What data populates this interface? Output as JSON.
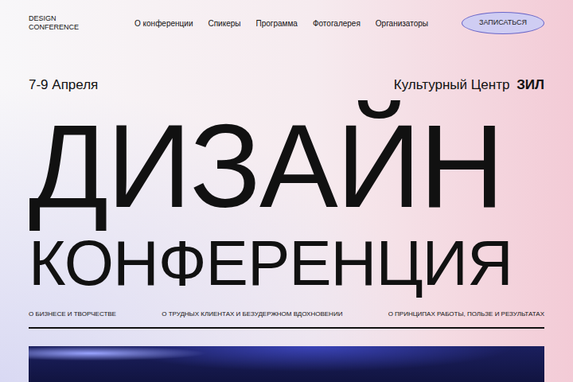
{
  "logo": [
    "DESIGN",
    "CONFERENCE"
  ],
  "nav": {
    "items": [
      "О конференции",
      "Спикеры",
      "Программа",
      "Фотогалерея",
      "Организаторы"
    ],
    "button": "ЗАПИСАТЬСЯ"
  },
  "event": {
    "date": "7-9 Апреля",
    "venue": "Культурный Центр",
    "venue_bold": "ЗИЛ"
  },
  "title": [
    "ДИЗАЙН",
    "КОНФЕРЕНЦИЯ"
  ],
  "taglines": [
    "О БИЗНЕСЕ И ТВОРЧЕСТВЕ",
    "О ТРУДНЫХ КЛИЕНТАХ И БЕЗУДЕРЖНОМ ВДОХНОВЕНИИ",
    "О ПРИНЦИПАХ РАБОТЫ, ПОЛЬЗЕ И РЕЗУЛЬТАТАХ"
  ]
}
